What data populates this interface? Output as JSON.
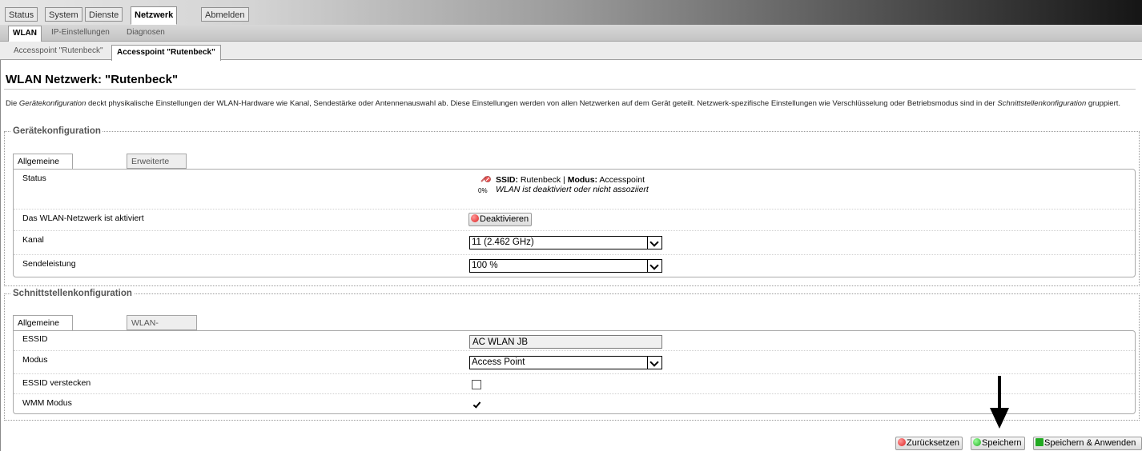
{
  "topmenu": {
    "status": "Status",
    "system": "System",
    "dienste": "Dienste",
    "netzwerk": "Netzwerk",
    "abmelden": "Abmelden"
  },
  "submenu1": {
    "wlan": "WLAN",
    "ip": "IP-Einstellungen",
    "diagnosen": "Diagnosen"
  },
  "submenu2": {
    "ap1": "Accesspoint \"Rutenbeck\"",
    "ap2": "Accesspoint \"Rutenbeck\""
  },
  "page_title": "WLAN Netzwerk: \"Rutenbeck\"",
  "description": {
    "p1": "Die ",
    "em1": "Gerätekonfiguration",
    "p2": " deckt physikalische Einstellungen der WLAN-Hardware wie Kanal, Sendestärke oder Antennenauswahl ab. Diese Einstellungen werden von allen Netzwerken auf dem Gerät geteilt. Netzwerk-spezifische Einstellungen wie Verschlüsselung oder Betriebsmodus sind in der ",
    "em2": "Schnittstellenkonfiguration",
    "p3": " gruppiert."
  },
  "device": {
    "legend": "Gerätekonfiguration",
    "tabs": [
      "Allgemeine Einstellungen",
      "Erweiterte Einstellungen"
    ],
    "status_label": "Status",
    "signal_pct": "0%",
    "ssid_key": "SSID:",
    "ssid_val": " Rutenbeck | ",
    "modus_key": "Modus:",
    "modus_val": " Accesspoint",
    "status_note": "WLAN ist deaktiviert oder nicht assoziiert",
    "enabled_label": "Das WLAN-Netzwerk ist aktiviert",
    "deactivate_button": "Deaktivieren",
    "channel_label": "Kanal",
    "channel_value": "11 (2.462 GHz)",
    "txpower_label": "Sendeleistung",
    "txpower_value": "100 %"
  },
  "iface": {
    "legend": "Schnittstellenkonfiguration",
    "tabs": [
      "Allgemeine Einstellungen",
      "WLAN-Verschlüsselung"
    ],
    "essid_label": "ESSID",
    "essid_value": "AC WLAN JB",
    "mode_label": "Modus",
    "mode_value": "Access Point",
    "hide_label": "ESSID verstecken",
    "hide_checked": false,
    "wmm_label": "WMM Modus",
    "wmm_checked": true
  },
  "actions": {
    "reset": "Zurücksetzen",
    "save": "Speichern",
    "save_apply": "Speichern & Anwenden"
  },
  "colors": {
    "reset_icon": "#dd2222",
    "save_icon": "#22aa22",
    "annotation_arrow": "#000000"
  }
}
